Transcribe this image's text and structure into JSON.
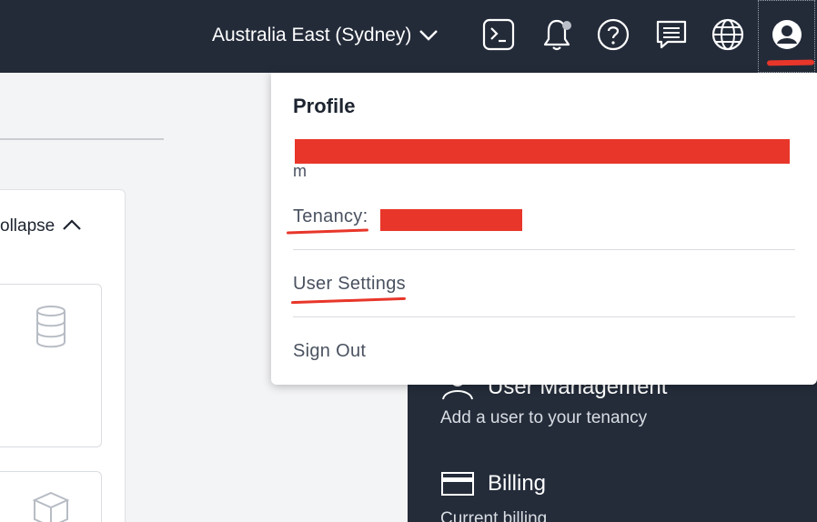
{
  "header": {
    "region_label": "Australia East (Sydney)",
    "icons": [
      "cloud-shell-icon",
      "bell-icon",
      "help-icon",
      "chat-icon",
      "globe-icon",
      "user-icon"
    ]
  },
  "left": {
    "collapse_label": "ollapse"
  },
  "profile_menu": {
    "title": "Profile",
    "email_tail": "m",
    "tenancy_label": "Tenancy:",
    "user_settings": "User Settings",
    "sign_out": "Sign Out"
  },
  "right_panel": {
    "user_mgmt_title": "User Management",
    "user_mgmt_desc": "Add a user to your tenancy",
    "billing_title": "Billing",
    "billing_desc": "Current billing"
  },
  "colors": {
    "topbar": "#232b39",
    "redaction": "#e8362a",
    "panel_dark": "#242c3a"
  }
}
